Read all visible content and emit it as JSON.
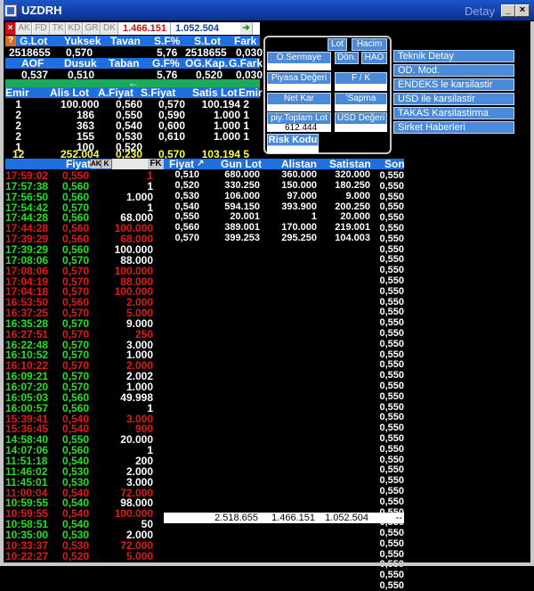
{
  "window": {
    "title": "UZDRH",
    "detail_label": "Detay"
  },
  "toolbar": {
    "tabs": [
      "AK",
      "FD",
      "TK",
      "KD",
      "GR",
      "DK"
    ],
    "volume": "1.466.151",
    "lot": "1.052.504"
  },
  "summary": {
    "row1_headers": [
      "G.Lot",
      "Yuksek",
      "Tavan",
      "S.F%",
      "S.Lot",
      "Fark"
    ],
    "row1_values": [
      "2518655",
      "0,570",
      "5,76",
      "2518655",
      "0,030"
    ],
    "row2_headers": [
      "AOF",
      "Dusuk",
      "Taban",
      "G.F%",
      "OG.Kap.",
      "G.Fark"
    ],
    "row2_values": [
      "0,537",
      "0,510",
      "5,76",
      "0,520",
      "0,030"
    ]
  },
  "orderbook": {
    "headers": [
      "Emir",
      "Alis Lot",
      "A.Fiyat",
      "S.Fiyat",
      "Satis Lot",
      "Emir"
    ],
    "rows": [
      [
        "1",
        "100.000",
        "0,560",
        "0,570",
        "100.194",
        "2"
      ],
      [
        "2",
        "186",
        "0,550",
        "0,590",
        "1.000",
        "1"
      ],
      [
        "2",
        "363",
        "0,540",
        "0,600",
        "1.000",
        "1"
      ],
      [
        "2",
        "155",
        "0,530",
        "0,610",
        "1.000",
        "1"
      ],
      [
        "1",
        "100",
        "0,520",
        "",
        "",
        ""
      ]
    ],
    "total": [
      "12",
      "252.004",
      "0,230",
      "0,570",
      "103.194",
      "5"
    ]
  },
  "infobox": {
    "buttons": [
      "Lot",
      "Hacim",
      "O.Sermaye",
      "Dön.",
      "HAO",
      "Piyasa Değeri",
      "F / K",
      "Net Kar",
      "'Sapma",
      "piy.Toplam Lot",
      "USD Değeri"
    ],
    "toplam_lot_value": "612.444",
    "risk_label": "Risk Kodu"
  },
  "side_buttons": [
    "Teknik Detay",
    "OD. Mod.",
    "ENDEKS le karsilastir",
    "USD ile karsilastir",
    "TAKAS Karsilastirma",
    "Sirket Haberleri"
  ],
  "trade_header": {
    "price": "Fiyat",
    "ak": "AK",
    "k": "K",
    "fk": "FK"
  },
  "trades": [
    [
      "17:59:02",
      "0,550",
      "1",
      "red"
    ],
    [
      "17:57:38",
      "0,560",
      "1",
      "grn"
    ],
    [
      "17:56:50",
      "0,560",
      "1.000",
      "grn"
    ],
    [
      "17:54:42",
      "0,570",
      "1",
      "grn"
    ],
    [
      "17:44:28",
      "0,560",
      "68.000",
      "grn"
    ],
    [
      "17:44:28",
      "0,560",
      "100.000",
      "red"
    ],
    [
      "17:39:29",
      "0,560",
      "68.000",
      "red"
    ],
    [
      "17:39:29",
      "0,560",
      "100.000",
      "grn"
    ],
    [
      "17:08:06",
      "0,570",
      "88.000",
      "grn"
    ],
    [
      "17:08:06",
      "0,570",
      "100.000",
      "red"
    ],
    [
      "17:04:19",
      "0,570",
      "88.000",
      "red"
    ],
    [
      "17:04:18",
      "0,570",
      "100.000",
      "red"
    ],
    [
      "16:53:50",
      "0,560",
      "2.000",
      "red"
    ],
    [
      "16:37:25",
      "0,570",
      "5.000",
      "red"
    ],
    [
      "16:35:28",
      "0,570",
      "9.000",
      "grn"
    ],
    [
      "16:27:51",
      "0,570",
      "250",
      "red"
    ],
    [
      "16:22:48",
      "0,570",
      "3.000",
      "grn"
    ],
    [
      "16:10:52",
      "0,570",
      "1.000",
      "grn"
    ],
    [
      "16:10:22",
      "0,570",
      "2.000",
      "red"
    ],
    [
      "16:09:21",
      "0,570",
      "2.002",
      "grn"
    ],
    [
      "16:07:20",
      "0,570",
      "1.000",
      "grn"
    ],
    [
      "16:05:03",
      "0,560",
      "49.998",
      "grn"
    ],
    [
      "16:00:57",
      "0,560",
      "1",
      "grn"
    ],
    [
      "15:39:41",
      "0,540",
      "3.000",
      "red"
    ],
    [
      "15:36:45",
      "0,540",
      "900",
      "red"
    ],
    [
      "14:58:40",
      "0,550",
      "20.000",
      "grn"
    ],
    [
      "14:07:06",
      "0,560",
      "1",
      "grn"
    ],
    [
      "11:51:18",
      "0,540",
      "200",
      "grn"
    ],
    [
      "11:46:02",
      "0,530",
      "2.000",
      "grn"
    ],
    [
      "11:45:01",
      "0,530",
      "3.000",
      "grn"
    ],
    [
      "11:00:04",
      "0,540",
      "72.000",
      "red"
    ],
    [
      "10:59:55",
      "0,540",
      "98.000",
      "grn"
    ],
    [
      "10:59:55",
      "0,540",
      "100.000",
      "red"
    ],
    [
      "10:58:51",
      "0,540",
      "50",
      "grn"
    ],
    [
      "10:35:00",
      "0,530",
      "2.000",
      "grn"
    ],
    [
      "10:33:37",
      "0,530",
      "72.000",
      "red"
    ],
    [
      "10:22:27",
      "0,520",
      "5.000",
      "red"
    ]
  ],
  "depth_headers": [
    "Fiyat",
    "Gun Lot",
    "Alistan",
    "Satistan",
    "Son"
  ],
  "depth_rows": [
    [
      "0,510",
      "680.000",
      "360.000",
      "320.000",
      "0,550"
    ],
    [
      "0,520",
      "330.250",
      "150.000",
      "180.250",
      "0,550"
    ],
    [
      "0,530",
      "106.000",
      "97.000",
      "9.000",
      "0,550"
    ],
    [
      "0,540",
      "594.150",
      "393.900",
      "200.250",
      "0,550"
    ],
    [
      "0,550",
      "20.001",
      "1",
      "20.000",
      "0,550"
    ],
    [
      "0,560",
      "389.001",
      "170.000",
      "219.001",
      "0,550"
    ],
    [
      "0,570",
      "399.253",
      "295.250",
      "104.003",
      "0,550"
    ]
  ],
  "son_column": [
    "0,550",
    "0,550",
    "0,550",
    "0,550",
    "0,550",
    "0,550",
    "0,550",
    "0,550",
    "0,550",
    "0,550",
    "0,550",
    "0,550",
    "0,550",
    "0,550",
    "0,550",
    "0,550",
    "0,550",
    "0,550",
    "0,550",
    "0,550",
    "0,550",
    "0,550",
    "0,550",
    "0,550",
    "0,550",
    "0,550",
    "0,550",
    "0,550",
    "0,550",
    "0,550",
    "0,550",
    "0,550",
    "0,550"
  ],
  "totals": [
    "2.518.655",
    "1.466.151",
    "1.052.504",
    "--"
  ],
  "colors": {
    "header_blue": "#1e6fe0",
    "button_blue": "#4a8ad8",
    "up": "#22e022",
    "down": "#e01818",
    "titlebar": "#0a2e94"
  }
}
